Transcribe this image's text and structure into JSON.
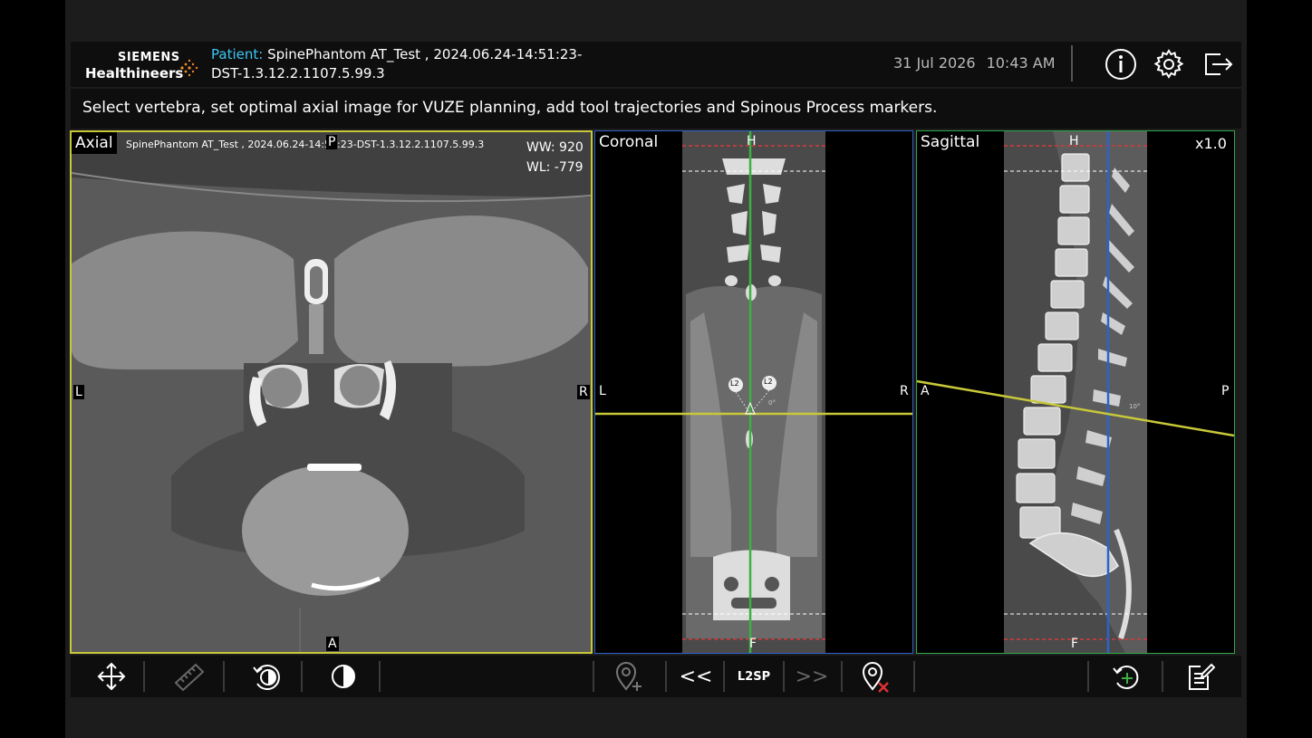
{
  "header": {
    "logo_top": "SIEMENS",
    "logo_bottom": "Healthineers",
    "patient_label": "Patient:",
    "patient_value": "SpinePhantom AT_Test , 2024.06.24-14:51:23-DST-1.3.12.2.1107.5.99.3",
    "date": "31 Jul 2026",
    "time": "10:43 AM",
    "icons": [
      "info-icon",
      "gear-icon",
      "logout-icon"
    ]
  },
  "instruction": "Select vertebra, set optimal axial image for VUZE planning, add tool trajectories and Spinous Process markers.",
  "viewports": {
    "axial": {
      "title": "Axial",
      "study": "SpinePhantom AT_Test , 2024.06.24-14:51:23-DST-1.3.12.2.1107.5.99.3",
      "ww": "WW: 920",
      "wl": "WL: -779",
      "top": "P",
      "bottom": "A",
      "left": "L",
      "right": "R",
      "border_color": "#c8c83a"
    },
    "coronal": {
      "title": "Coronal",
      "top": "H",
      "bottom": "F",
      "left": "L",
      "right": "R",
      "marker1": "L2",
      "marker2": "L2",
      "angle": "0°",
      "border_color": "#2f62c8"
    },
    "sagittal": {
      "title": "Sagittal",
      "zoom": "x1.0",
      "top": "H",
      "bottom": "F",
      "left": "A",
      "right": "P",
      "angle": "10°",
      "border_color": "#2fa84a"
    }
  },
  "toolbar": {
    "l2sp_label": "L2SP",
    "prev_label": "<<",
    "next_label": ">>",
    "icons": [
      "move-icon",
      "ruler-icon",
      "rotate-icon",
      "contrast-icon",
      "add-marker-icon",
      "remove-marker-icon",
      "reset-rotation-icon",
      "report-icon"
    ]
  },
  "colors": {
    "accent": "#3cc7f4",
    "trajectory_yellow": "#c8c83a",
    "plane_green": "#3cb043",
    "plane_blue": "#2f62c8",
    "limit_red": "#d43a3a"
  }
}
